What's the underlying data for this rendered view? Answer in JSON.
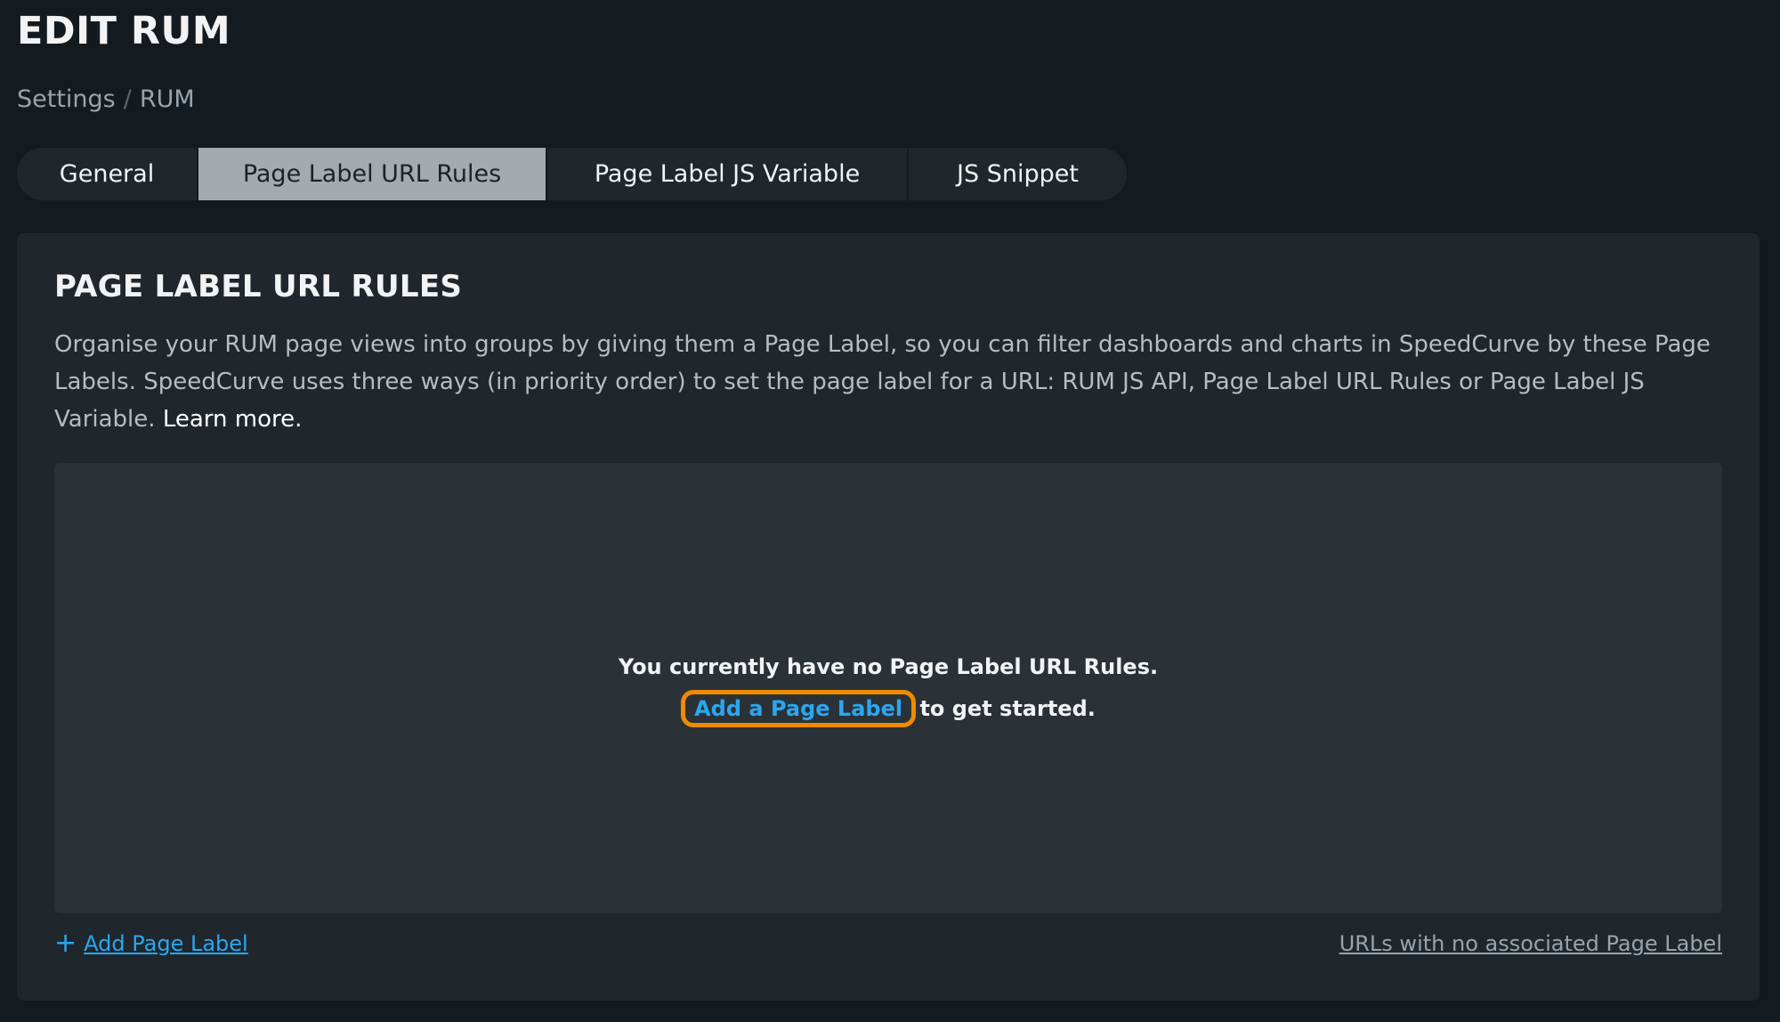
{
  "page": {
    "title": "EDIT RUM"
  },
  "breadcrumb": {
    "parent": "Settings",
    "separator": "/",
    "current": "RUM"
  },
  "tabs": [
    {
      "label": "General",
      "active": false
    },
    {
      "label": "Page Label URL Rules",
      "active": true
    },
    {
      "label": "Page Label JS Variable",
      "active": false
    },
    {
      "label": "JS Snippet",
      "active": false
    }
  ],
  "section": {
    "title": "PAGE LABEL URL RULES",
    "description": "Organise your RUM page views into groups by giving them a Page Label, so you can filter dashboards and charts in SpeedCurve by these Page Labels. SpeedCurve uses three ways (in priority order) to set the page label for a URL: RUM JS API, Page Label URL Rules or Page Label JS Variable.",
    "learn_more": "Learn more."
  },
  "empty_state": {
    "message": "You currently have no Page Label URL Rules.",
    "link_text": "Add a Page Label",
    "suffix": "to get started."
  },
  "footer": {
    "add_icon": "plus-icon",
    "add_label": "Add Page Label",
    "no_label_link": "URLs with no associated Page Label"
  },
  "colors": {
    "background": "#141b20",
    "panel": "#1f272d",
    "link": "#2aa7f0",
    "highlight": "#f08a00",
    "active_tab": "#a3abb0"
  }
}
